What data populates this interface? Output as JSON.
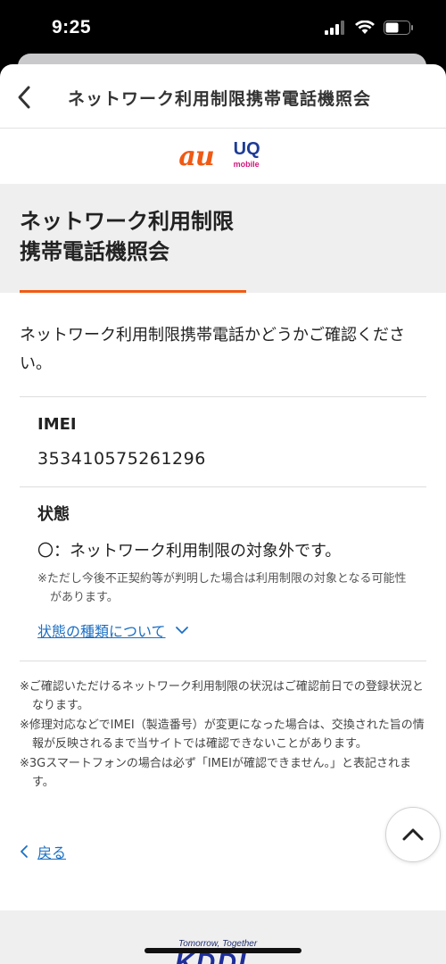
{
  "status_bar": {
    "time": "9:25"
  },
  "nav": {
    "title": "ネットワーク利用制限携帯電話機照会"
  },
  "logos": {
    "au": "au",
    "uq": "UQ",
    "uq_sub": "mobile"
  },
  "header": {
    "title_line1": "ネットワーク利用制限",
    "title_line2": "携帯電話機照会",
    "accent_color": "#ef5a14"
  },
  "intro": "ネットワーク利用制限携帯電話かどうかご確認ください。",
  "imei": {
    "label": "IMEI",
    "value": "353410575261296"
  },
  "status": {
    "label": "状態",
    "text": "〇：ネットワーク利用制限の対象外です。",
    "note": "※ただし今後不正契約等が判明した場合は利用制限の対象となる可能性があります。",
    "link_label": "状態の種類について"
  },
  "notes": [
    "※ご確認いただけるネットワーク利用制限の状況はご確認前日での登録状況となります。",
    "※修理対応などでIMEI（製造番号）が変更になった場合は、交換された旨の情報が反映されるまで当サイトでは確認できないことがあります。",
    "※3Gスマートフォンの場合は必ず「IMEIが確認できません。」と表記されます。"
  ],
  "back_link": "戻る",
  "footer": {
    "tagline": "Tomorrow, Together",
    "logo": "KDDI"
  },
  "icons": {
    "nav_back": "chevron-left-icon",
    "expand": "chevron-down-icon",
    "back": "chevron-left-icon",
    "scroll_top": "chevron-up-icon"
  },
  "colors": {
    "link": "#1a6fc4",
    "au_orange": "#ef5a14",
    "uq_blue": "#1e3c96",
    "uq_pink": "#d0187d"
  }
}
